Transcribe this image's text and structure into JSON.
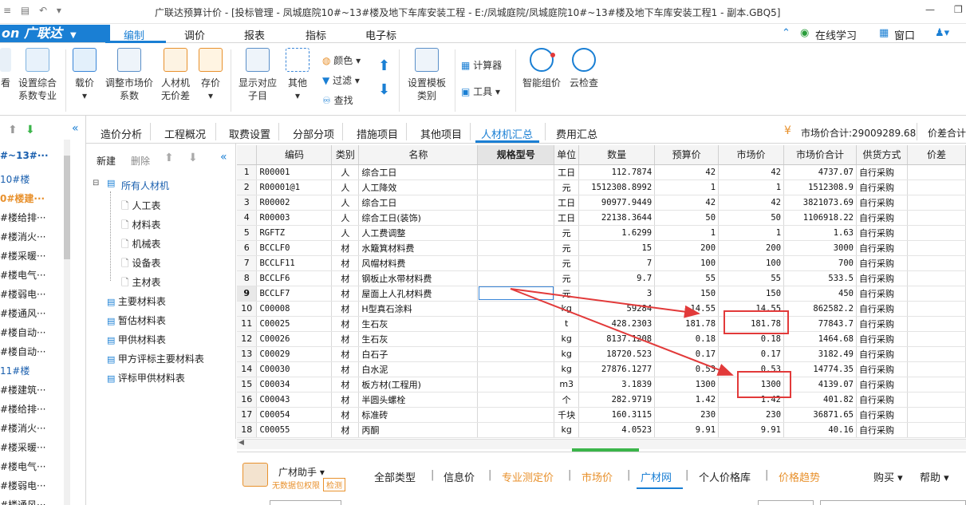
{
  "titlebar": {
    "title": "广联达预算计价 - [投标管理 - 凤城庭院10#~13#楼及地下车库安装工程 - E:/凤城庭院/凤城庭院10#~13#楼及地下车库安装工程1 - 副本.GBQ5]",
    "minimize": "—",
    "restore": "❐"
  },
  "logo": {
    "text": "on 广联达",
    "arrow": "▼"
  },
  "menu": [
    "编制",
    "调价",
    "报表",
    "指标",
    "电子标"
  ],
  "menu_right": {
    "online": "在线学习",
    "window": "窗口"
  },
  "ribbon": {
    "btn_view": "看",
    "btn_set_coef": [
      "设置综合",
      "系数专业"
    ],
    "btn_load_price": [
      "载价",
      "▾"
    ],
    "btn_adjust": [
      "调整市场价",
      "系数"
    ],
    "btn_labor": [
      "人材机",
      "无价差"
    ],
    "btn_save_price": [
      "存价",
      "▾"
    ],
    "btn_show_items": [
      "显示对应",
      "子目"
    ],
    "btn_other": [
      "其他",
      "▾"
    ],
    "color": "颜色",
    "filter": "过滤",
    "find": "查找",
    "btn_template": [
      "设置模板",
      "类别"
    ],
    "calculator": "计算器",
    "tools": "工具",
    "btn_smart": "智能组价",
    "btn_cloud": "云检查"
  },
  "tabs": [
    "造价分析",
    "工程概况",
    "取费设置",
    "分部分项",
    "措施项目",
    "其他项目",
    "人材机汇总",
    "费用汇总"
  ],
  "tabs_right": {
    "market_total": "市场价合计:29009289.68",
    "diff_total": "价差合计"
  },
  "leftnav": {
    "items": [
      "#~13#···",
      "10#楼",
      "0#楼建···",
      "#楼给排···",
      "#楼消火···",
      "#楼采暖···",
      "#楼电气···",
      "#楼弱电···",
      "#楼通风···",
      "#楼自动···",
      "#楼自动···",
      "11#楼",
      "#楼建筑···",
      "#楼给排···",
      "#楼消火···",
      "#楼采暖···",
      "#楼电气···",
      "#楼弱电···",
      "#楼通风···"
    ]
  },
  "tree": {
    "toolbar": {
      "new": "新建",
      "delete": "删除"
    },
    "root": "所有人材机",
    "children": [
      "人工表",
      "材料表",
      "机械表",
      "设备表",
      "主材表"
    ],
    "others": [
      "主要材料表",
      "暂估材料表",
      "甲供材料表",
      "甲方评标主要材料表",
      "评标甲供材料表"
    ]
  },
  "grid": {
    "headers": [
      "编码",
      "类别",
      "名称",
      "规格型号",
      "单位",
      "数量",
      "预算价",
      "市场价",
      "市场价合计",
      "供货方式",
      "价差"
    ],
    "rows": [
      [
        "1",
        "R00001",
        "人",
        "综合工日",
        "",
        "工日",
        "112.7874",
        "42",
        "42",
        "4737.07",
        "自行采购"
      ],
      [
        "2",
        "R00001@1",
        "人",
        "人工降效",
        "",
        "元",
        "1512308.8992",
        "1",
        "1",
        "1512308.9",
        "自行采购"
      ],
      [
        "3",
        "R00002",
        "人",
        "综合工日",
        "",
        "工日",
        "90977.9449",
        "42",
        "42",
        "3821073.69",
        "自行采购"
      ],
      [
        "4",
        "R00003",
        "人",
        "综合工日(装饰)",
        "",
        "工日",
        "22138.3644",
        "50",
        "50",
        "1106918.22",
        "自行采购"
      ],
      [
        "5",
        "RGFTZ",
        "人",
        "人工费调整",
        "",
        "元",
        "1.6299",
        "1",
        "1",
        "1.63",
        "自行采购"
      ],
      [
        "6",
        "BCCLF0",
        "材",
        "水簸箕材料费",
        "",
        "元",
        "15",
        "200",
        "200",
        "3000",
        "自行采购"
      ],
      [
        "7",
        "BCCLF11",
        "材",
        "风帽材料费",
        "",
        "元",
        "7",
        "100",
        "100",
        "700",
        "自行采购"
      ],
      [
        "8",
        "BCCLF6",
        "材",
        "钢板止水带材料费",
        "",
        "元",
        "9.7",
        "55",
        "55",
        "533.5",
        "自行采购"
      ],
      [
        "9",
        "BCCLF7",
        "材",
        "屋面上人孔材料费",
        "",
        "元",
        "3",
        "150",
        "150",
        "450",
        "自行采购"
      ],
      [
        "10",
        "C00008",
        "材",
        "H型真石涂料",
        "",
        "kg",
        "59284",
        "14.55",
        "14.55",
        "862582.2",
        "自行采购"
      ],
      [
        "11",
        "C00025",
        "材",
        "生石灰",
        "",
        "t",
        "428.2303",
        "181.78",
        "181.78",
        "77843.7",
        "自行采购"
      ],
      [
        "12",
        "C00026",
        "材",
        "生石灰",
        "",
        "kg",
        "8137.1208",
        "0.18",
        "0.18",
        "1464.68",
        "自行采购"
      ],
      [
        "13",
        "C00029",
        "材",
        "白石子",
        "",
        "kg",
        "18720.523",
        "0.17",
        "0.17",
        "3182.49",
        "自行采购"
      ],
      [
        "14",
        "C00030",
        "材",
        "白水泥",
        "",
        "kg",
        "27876.1277",
        "0.53",
        "0.53",
        "14774.35",
        "自行采购"
      ],
      [
        "15",
        "C00034",
        "材",
        "板方材(工程用)",
        "",
        "m3",
        "3.1839",
        "1300",
        "1300",
        "4139.07",
        "自行采购"
      ],
      [
        "16",
        "C00043",
        "材",
        "半圆头螺栓",
        "",
        "个",
        "282.9719",
        "1.42",
        "1.42",
        "401.82",
        "自行采购"
      ],
      [
        "17",
        "C00054",
        "材",
        "标准砖",
        "",
        "千块",
        "160.3115",
        "230",
        "230",
        "36871.65",
        "自行采购"
      ],
      [
        "18",
        "C00055",
        "材",
        "丙酮",
        "",
        "kg",
        "4.0523",
        "9.91",
        "9.91",
        "40.16",
        "自行采购"
      ]
    ],
    "selected_row": "9"
  },
  "assistant": {
    "name": "广材助手",
    "sub": "无数据包权限",
    "sub_btn": "检测",
    "tabs": [
      "全部类型",
      "信息价",
      "专业测定价",
      "市场价",
      "广材网",
      "个人价格库",
      "价格趋势"
    ],
    "buy": "购买",
    "help": "帮助"
  },
  "colors": {
    "accent": "#1a7fd4",
    "annotation": "#e23a3a",
    "orange": "#e8912d"
  }
}
